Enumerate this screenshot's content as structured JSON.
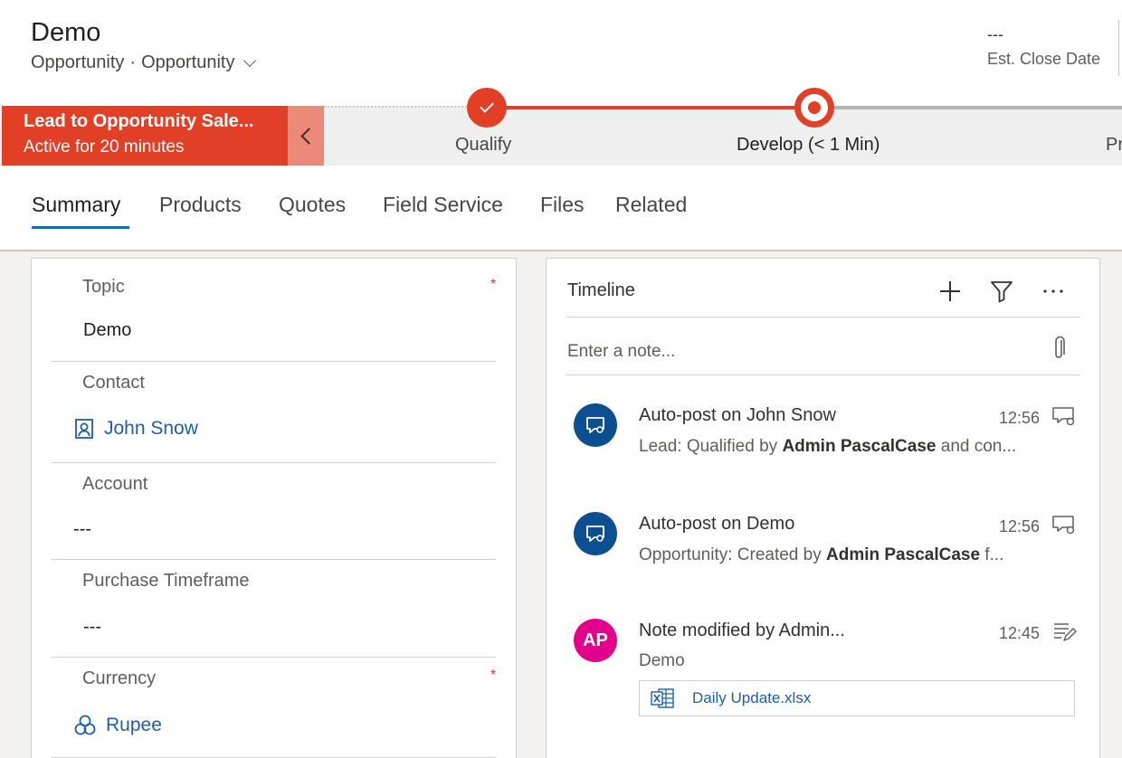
{
  "header": {
    "title": "Demo",
    "entity": "Opportunity",
    "separator": "·",
    "form_name": "Opportunity",
    "field": {
      "value": "---",
      "label": "Est. Close Date"
    }
  },
  "bpf": {
    "process_name": "Lead to Opportunity Sale...",
    "active_for": "Active for 20 minutes",
    "stages": [
      {
        "label": "Qualify"
      },
      {
        "label": "Develop  (< 1 Min)"
      },
      {
        "label": "Pr"
      }
    ]
  },
  "tabs": [
    {
      "label": "Summary"
    },
    {
      "label": "Products"
    },
    {
      "label": "Quotes"
    },
    {
      "label": "Field Service"
    },
    {
      "label": "Files"
    },
    {
      "label": "Related"
    }
  ],
  "form": {
    "required_mark": "*",
    "topic": {
      "label": "Topic",
      "value": "Demo"
    },
    "contact": {
      "label": "Contact",
      "value": "John Snow"
    },
    "account": {
      "label": "Account",
      "value": "---"
    },
    "purchase_timeframe": {
      "label": "Purchase Timeframe",
      "value": "---"
    },
    "currency": {
      "label": "Currency",
      "value": "Rupee"
    }
  },
  "timeline": {
    "title": "Timeline",
    "note_placeholder": "Enter a note...",
    "posts": [
      {
        "title": "Auto-post on John Snow",
        "time": "12:56",
        "body_prefix": "Lead: Qualified by ",
        "body_bold": "Admin PascalCase",
        "body_suffix": " and con..."
      },
      {
        "title": "Auto-post on Demo",
        "time": "12:56",
        "body_prefix": "Opportunity: Created by ",
        "body_bold": "Admin PascalCase",
        "body_suffix": " f..."
      },
      {
        "initials": "AP",
        "title": "Note modified by Admin...",
        "time": "12:45",
        "body": "Demo",
        "attachment": "Daily Update.xlsx"
      }
    ]
  },
  "colors": {
    "accent_red": "#e13f26",
    "link_blue": "#1f5fa8",
    "tab_underline": "#0f6cbd",
    "avatar_blue": "#0b4f91",
    "avatar_pink": "#e3008c"
  }
}
